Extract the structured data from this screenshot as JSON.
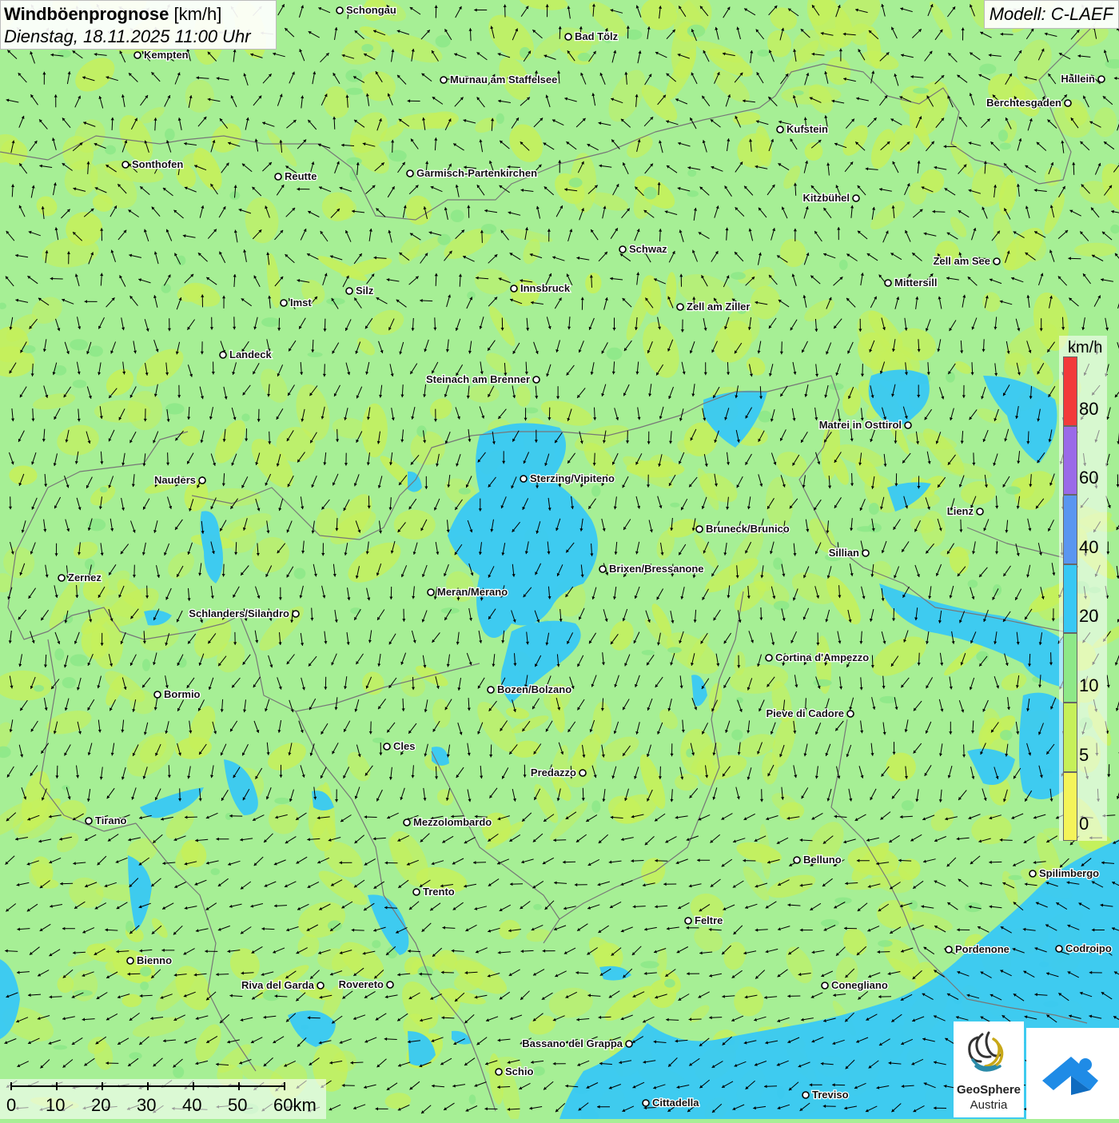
{
  "title": {
    "main": "Windböenprognose",
    "unit": "[km/h]",
    "datetime": "Dienstag, 18.11.2025 11:00 Uhr"
  },
  "model": "Modell: C-LAEF",
  "legend": {
    "unit": "km/h",
    "labels": [
      "80",
      "60",
      "40",
      "20",
      "10",
      "5",
      "0"
    ],
    "classes": [
      {
        "label": "80",
        "color": "#f23a3a"
      },
      {
        "label": "60",
        "color": "#9a6ae8"
      },
      {
        "label": "40",
        "color": "#5a96f0"
      },
      {
        "label": "20",
        "color": "#38c8f4"
      },
      {
        "label": "10",
        "color": "#8ee888"
      },
      {
        "label": "5",
        "color": "#c6f05a"
      },
      {
        "label": "0",
        "color": "#f4f45a"
      }
    ]
  },
  "scale": {
    "labels": [
      "0",
      "10",
      "20",
      "30",
      "40",
      "50",
      "60km"
    ]
  },
  "logos": {
    "geosphere_line1": "GeoSphere",
    "geosphere_line2": "Austria"
  },
  "places": [
    "Schongau",
    "Bad Tölz",
    "Kempten",
    "Murnau am Staffelsee",
    "Hallein",
    "Berchtesgaden",
    "Kufstein",
    "Sonthofen",
    "Reutte",
    "Garmisch-Partenkirchen",
    "Kitzbühel",
    "Schwaz",
    "Zell am See",
    "Mittersill",
    "Innsbruck",
    "Silz",
    "Imst",
    "Zell am Ziller",
    "Landeck",
    "Steinach am Brenner",
    "Matrei in Osttirol",
    "Nauders",
    "Sterzing/Vipiteno",
    "Lienz",
    "Bruneck/Brunico",
    "Sillian",
    "Brixen/Bressanone",
    "Zernez",
    "Meran/Merano",
    "Schlanders/Silandro",
    "Cortina d'Ampezzo",
    "Bormio",
    "Bozen/Bolzano",
    "Pieve di Cadore",
    "Cles",
    "Predazzo",
    "Tirano",
    "Mezzolombardo",
    "Belluno",
    "Spilimbergo",
    "Trento",
    "Feltre",
    "Bienno",
    "Pordenone",
    "Codroipo",
    "Riva del Garda",
    "Rovereto",
    "Conegliano",
    "Bassano del Grappa",
    "Schio",
    "Treviso",
    "Cittadella"
  ],
  "colors": {
    "background": "#a6ef95",
    "wind_10_20": "#8ee888",
    "wind_5_10": "#c6f05a",
    "wind_20_40": "#38c8f4",
    "sea": "#38c8f4",
    "border": "#777777",
    "arrow": "#000000"
  }
}
